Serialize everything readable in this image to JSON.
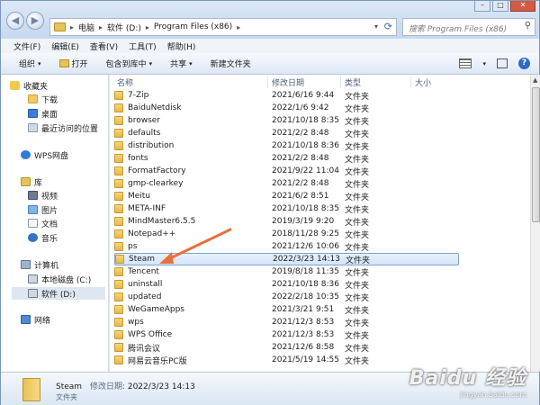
{
  "address": {
    "crumbs": [
      "电脑",
      "软件 (D:)",
      "Program Files (x86)"
    ],
    "search_placeholder": "搜索 Program Files (x86)"
  },
  "menubar": [
    "文件(F)",
    "编辑(E)",
    "查看(V)",
    "工具(T)",
    "帮助(H)"
  ],
  "toolbar": {
    "organize": "组织",
    "open": "打开",
    "include_in_library": "包含到库中",
    "share": "共享",
    "new_folder": "新建文件夹"
  },
  "nav": {
    "favorites": "收藏夹",
    "downloads": "下载",
    "desktop": "桌面",
    "recent": "最近访问的位置",
    "wps_cloud": "WPS网盘",
    "libraries": "库",
    "videos": "视频",
    "pictures": "图片",
    "documents": "文档",
    "music": "音乐",
    "computer": "计算机",
    "local_disk": "本地磁盘 (C:)",
    "software_disk": "软件 (D:)",
    "network": "网络"
  },
  "columns": {
    "name": "名称",
    "date": "修改日期",
    "type": "类型",
    "size": "大小"
  },
  "files": [
    {
      "name": "7-Zip",
      "date": "2021/6/16 9:44",
      "type": "文件夹"
    },
    {
      "name": "BaiduNetdisk",
      "date": "2022/1/6 9:42",
      "type": "文件夹"
    },
    {
      "name": "browser",
      "date": "2021/10/18 8:35",
      "type": "文件夹"
    },
    {
      "name": "defaults",
      "date": "2021/2/2 8:48",
      "type": "文件夹"
    },
    {
      "name": "distribution",
      "date": "2021/10/18 8:36",
      "type": "文件夹"
    },
    {
      "name": "fonts",
      "date": "2021/2/2 8:48",
      "type": "文件夹"
    },
    {
      "name": "FormatFactory",
      "date": "2021/9/22 11:04",
      "type": "文件夹"
    },
    {
      "name": "gmp-clearkey",
      "date": "2021/2/2 8:48",
      "type": "文件夹"
    },
    {
      "name": "Meitu",
      "date": "2021/6/2 8:51",
      "type": "文件夹"
    },
    {
      "name": "META-INF",
      "date": "2021/10/18 8:35",
      "type": "文件夹"
    },
    {
      "name": "MindMaster6.5.5",
      "date": "2019/3/19 9:20",
      "type": "文件夹"
    },
    {
      "name": "Notepad++",
      "date": "2018/11/28 9:25",
      "type": "文件夹"
    },
    {
      "name": "ps",
      "date": "2021/12/6 10:06",
      "type": "文件夹"
    },
    {
      "name": "Steam",
      "date": "2022/3/23 14:13",
      "type": "文件夹"
    },
    {
      "name": "Tencent",
      "date": "2019/8/18 11:35",
      "type": "文件夹"
    },
    {
      "name": "uninstall",
      "date": "2021/10/18 8:36",
      "type": "文件夹"
    },
    {
      "name": "updated",
      "date": "2022/2/18 10:35",
      "type": "文件夹"
    },
    {
      "name": "WeGameApps",
      "date": "2021/3/21 9:51",
      "type": "文件夹"
    },
    {
      "name": "wps",
      "date": "2021/12/3 8:53",
      "type": "文件夹"
    },
    {
      "name": "WPS Office",
      "date": "2021/12/3 8:53",
      "type": "文件夹"
    },
    {
      "name": "腾讯会议",
      "date": "2021/12/6 8:58",
      "type": "文件夹"
    },
    {
      "name": "网易云音乐PC版",
      "date": "2021/5/19 14:55",
      "type": "文件夹"
    }
  ],
  "details": {
    "name": "Steam",
    "modified_label": "修改日期:",
    "modified": "2022/3/23 14:13",
    "type": "文件夹"
  },
  "watermark": {
    "line1": "Baidu 经验",
    "line2": "jingyan.baidu.com"
  },
  "colors": {
    "selection": "#d3e5fa",
    "folder": "#e8b746",
    "annotation_arrow": "#e8703a"
  }
}
